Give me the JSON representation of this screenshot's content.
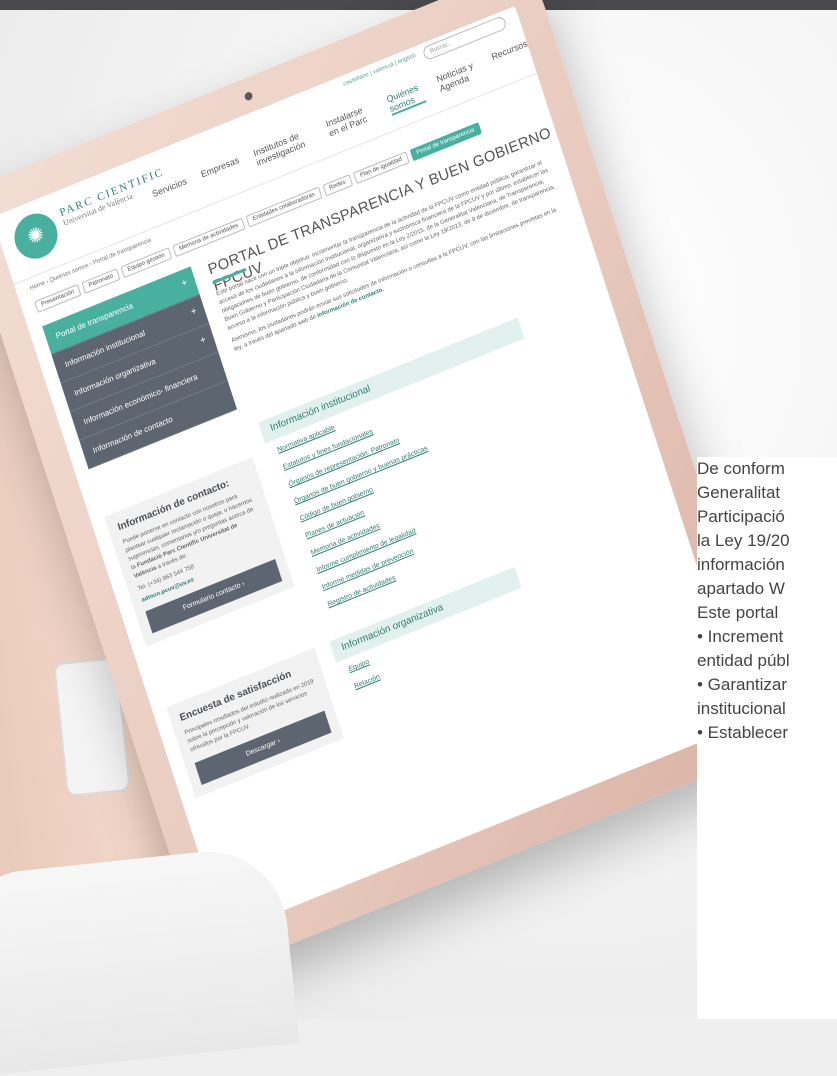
{
  "portal": {
    "logo": {
      "line1": "PARC CIENTIFIC",
      "line2": "Universitat de València"
    },
    "lang_switch": "castellano | valencià | english",
    "search_placeholder": "Buscar...",
    "nav": [
      "Servicios",
      "Empresas",
      "Institutos de investigación",
      "Instalarse en el Parc",
      "Quiénes somos",
      "Noticias y Agenda",
      "Recursos"
    ],
    "breadcrumb": "Home › Quiénes somos › Portal de transparencia",
    "subtabs": [
      "Presentación",
      "Patronato",
      "Equipo gestión",
      "Memoria de actividades",
      "Entidades colaboradoras",
      "Redes",
      "Plan de igualdad",
      "Portal de transparencia"
    ],
    "title": "PORTAL DE TRANSPARENCIA Y BUEN GOBIERNO FPCUV",
    "intro": "Este portal nace con un triple objetivo: incrementar la transparencia de la actividad de la FPCUV como entidad pública; garantizar el acceso de los ciudadanos a la información institucional, organizativa y económica financiera de la FPCUV y por último, establecer las obligaciones de buen gobierno, de conformidad con lo dispuesto en la Ley 2/2015, de la Generalitat Valenciana, de Transparencia, Buen Gobierno y Participación Ciudadana de la Comunitat Valenciana, así como la Ley 19/2013, de 9 de diciembre, de transparencia, acceso a la información pública y buen gobierno.",
    "intro2": "Asimismo, los ciudadanos podrán enviar sus solicitudes de información o consultas a la FPCUV, con las limitaciones previstas en la ley, a través del apartado web de",
    "intro2_link": "información de contacto.",
    "sidebar": [
      "Portal de transparencia",
      "Información institucional",
      "Información organizativa",
      "Información económico- financiera",
      "Información de contacto"
    ],
    "contact": {
      "heading": "Información de contacto:",
      "text": "Puede ponerse en contacto con nosotros para plantear cualquier reclamación o queja, o hacernos sugerencias, comentarios y/o preguntas acerca de la",
      "org": "Fundació Parc Científic Universitat de València",
      "suffix": "a través de:",
      "phone": "Tel. (+34) 963 544 758",
      "email": "admon.pcuv@uv.es",
      "button": "Formulario contacto ›"
    },
    "survey": {
      "heading": "Encuesta de satisfacción",
      "text": "Principales resultados del estudio realizado en 2019 sobre la percepción y valoración de los servicios ofrecidos por la FPCUV.",
      "button": "Descargar ›"
    },
    "section1": {
      "heading": "Información institucional",
      "links": [
        "Normativa aplicable",
        "Estatutos y fines fundacionales",
        "Órganos de representación: Patronato",
        "Órganos de buen gobierno y buenas prácticas",
        "Código de buen gobierno",
        "Planes de actuación",
        "Memoria de actividades",
        "Informe cumplimiento de legalidad",
        "Informe medidas de prevención",
        "Registro de actividades"
      ]
    },
    "section2": {
      "heading": "Información organizativa",
      "links": [
        "Equipo",
        "Relación"
      ]
    }
  },
  "overlay_text": [
    "De conform",
    "Generalitat",
    "Participació",
    "la Ley 19/20",
    "información",
    "apartado W",
    "",
    "Este portal",
    "• Increment",
    "entidad públ",
    "• Garantizar",
    "institucional",
    "• Establecer"
  ]
}
